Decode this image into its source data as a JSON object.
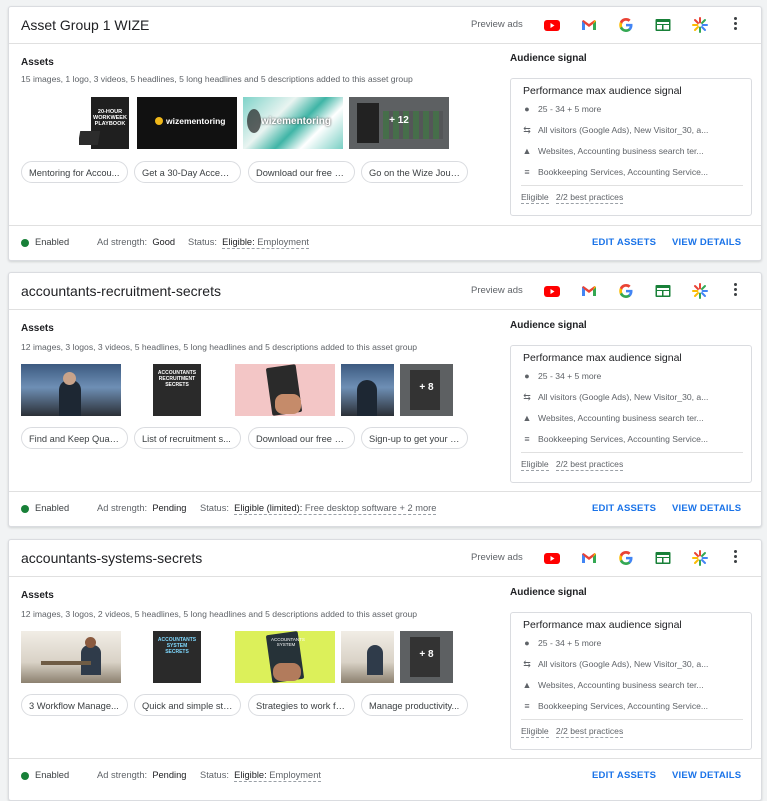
{
  "preview_label": "Preview ads",
  "assets_label": "Assets",
  "audience_label": "Audience signal",
  "audience_box_title": "Performance max audience signal",
  "edit_label": "EDIT ASSETS",
  "view_label": "VIEW DETAILS",
  "ad_strength_label": "Ad strength:",
  "status_label": "Status:",
  "channel_icons": [
    "youtube-icon",
    "gmail-icon",
    "google-search-icon",
    "display-icon",
    "discover-icon"
  ],
  "groups": [
    {
      "title": "Asset Group 1 WIZE",
      "summary": "15 images, 1 logo, 3 videos, 5 headlines, 5 long headlines and 5 descriptions added to this asset group",
      "thumb_texts": [
        "20-HOUR WORKWEEK PLAYBOOK",
        "wizementoring",
        "wizementoring",
        "+ 12"
      ],
      "chips": [
        "Mentoring for Accou...",
        "Get a 30-Day Access...",
        "Download our free b...",
        "Go on the Wize Jour..."
      ],
      "audience": [
        "25 - 34 + 5 more",
        "All visitors (Google Ads), New Visitor_30, a...",
        "Websites, Accounting business search ter...",
        "Bookkeeping Services, Accounting Service..."
      ],
      "eligible": "Eligible",
      "best_practices": "2/2 best practices",
      "enabled": "Enabled",
      "ad_strength": "Good",
      "status_value": "Eligible:",
      "status_detail": "Employment"
    },
    {
      "title": "accountants-recruitment-secrets",
      "summary": "12 images, 3 logos, 3 videos, 5 headlines, 5 long headlines and 5 descriptions added to this asset group",
      "thumb_texts": [
        "",
        "ACCOUNTANTS RECRUITMENT SECRETS",
        "",
        "",
        "+ 8"
      ],
      "chips": [
        "Find and Keep Quali...",
        "List of recruitment s...",
        "Download our free b...",
        "Sign-up to get your f..."
      ],
      "audience": [
        "25 - 34 + 5 more",
        "All visitors (Google Ads), New Visitor_30, a...",
        "Websites, Accounting business search ter...",
        "Bookkeeping Services, Accounting Service..."
      ],
      "eligible": "Eligible",
      "best_practices": "2/2 best practices",
      "enabled": "Enabled",
      "ad_strength": "Pending",
      "status_value": "Eligible (limited):",
      "status_detail": "Free desktop software + 2 more"
    },
    {
      "title": "accountants-systems-secrets",
      "summary": "12 images, 3 logos, 2 videos, 5 headlines, 5 long headlines and 5 descriptions added to this asset group",
      "thumb_texts": [
        "",
        "ACCOUNTANTS SYSTEM SECRETS",
        "ACCOUNTANTS SYSTEM",
        "",
        "+ 8"
      ],
      "chips": [
        "3 Workflow Manage...",
        "Quick and simple str...",
        "Strategies to work fa...",
        "Manage productivity..."
      ],
      "audience": [
        "25 - 34 + 5 more",
        "All visitors (Google Ads), New Visitor_30, a...",
        "Websites, Accounting business search ter...",
        "Bookkeeping Services, Accounting Service..."
      ],
      "eligible": "Eligible",
      "best_practices": "2/2 best practices",
      "enabled": "Enabled",
      "ad_strength": "Pending",
      "status_value": "Eligible:",
      "status_detail": "Employment"
    }
  ]
}
